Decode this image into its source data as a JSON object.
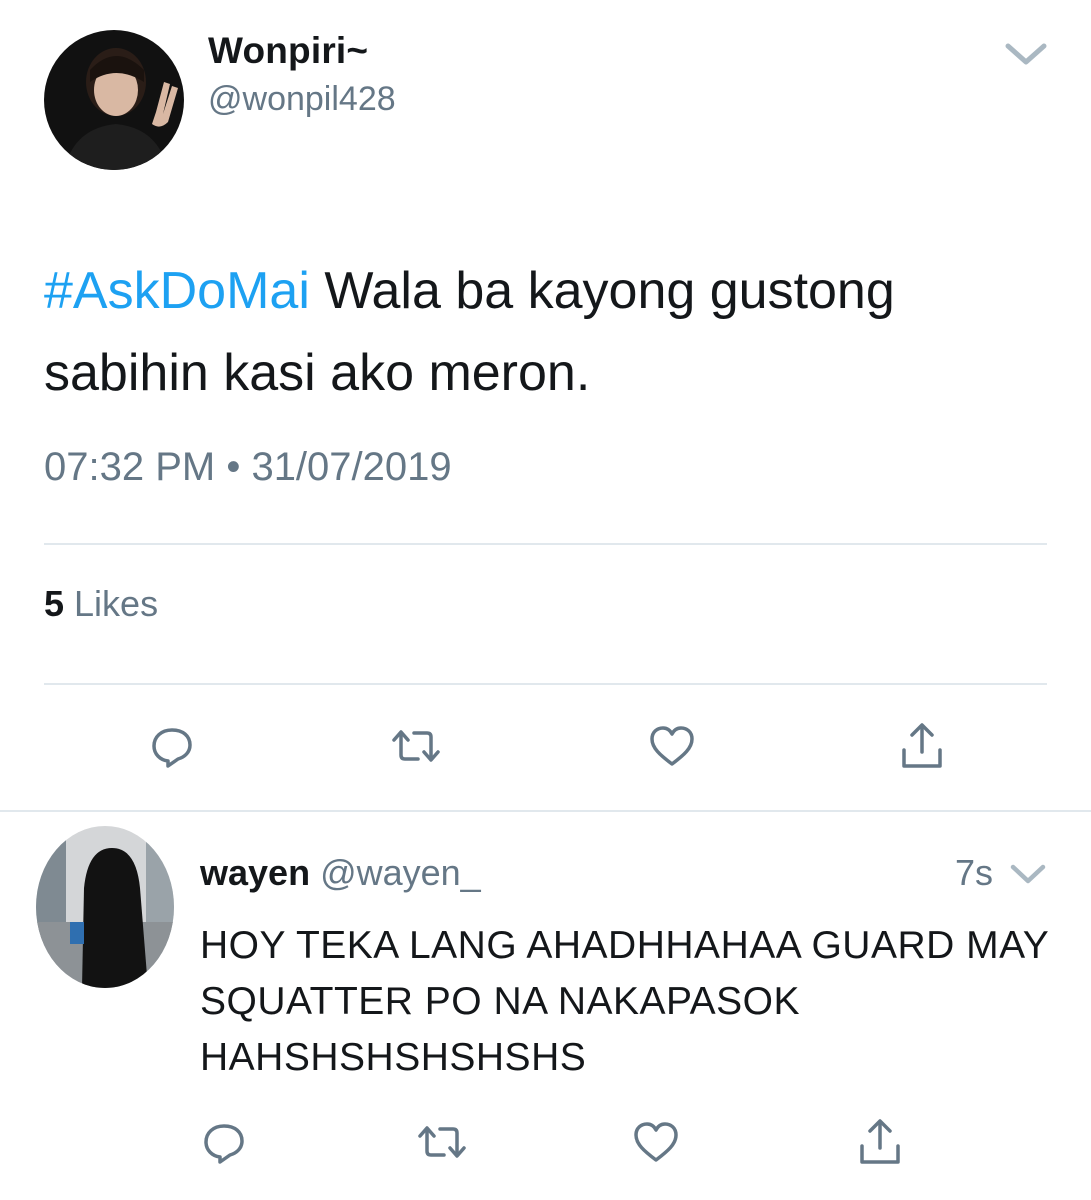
{
  "main_tweet": {
    "author": {
      "name": "Wonpiri~",
      "handle": "@wonpil428",
      "avatar_icon": "avatar-photo"
    },
    "text": {
      "hashtag": "#AskDoMai",
      "body": " Wala ba kayong gustong sabihin kasi ako meron."
    },
    "timestamp": "07:32 PM • 31/07/2019",
    "likes": {
      "count": "5",
      "label": " Likes"
    },
    "actions": [
      "reply-icon",
      "retweet-icon",
      "like-icon",
      "share-icon"
    ]
  },
  "reply": {
    "author": {
      "name": "wayen",
      "handle": "@wayen_",
      "avatar_icon": "avatar-photo"
    },
    "time": "7s",
    "text": "HOY TEKA LANG AHADHHAHAA GUARD MAY SQUATTER PO NA NAKAPASOK HAHSHSHSHSHSHS",
    "actions": [
      "reply-icon",
      "retweet-icon",
      "like-icon",
      "share-icon"
    ]
  },
  "colors": {
    "hashtag": "#1da1f2",
    "secondary_text": "#657786",
    "primary_text": "#14171a",
    "divider": "#e1e8ed",
    "icon": "#657786"
  }
}
